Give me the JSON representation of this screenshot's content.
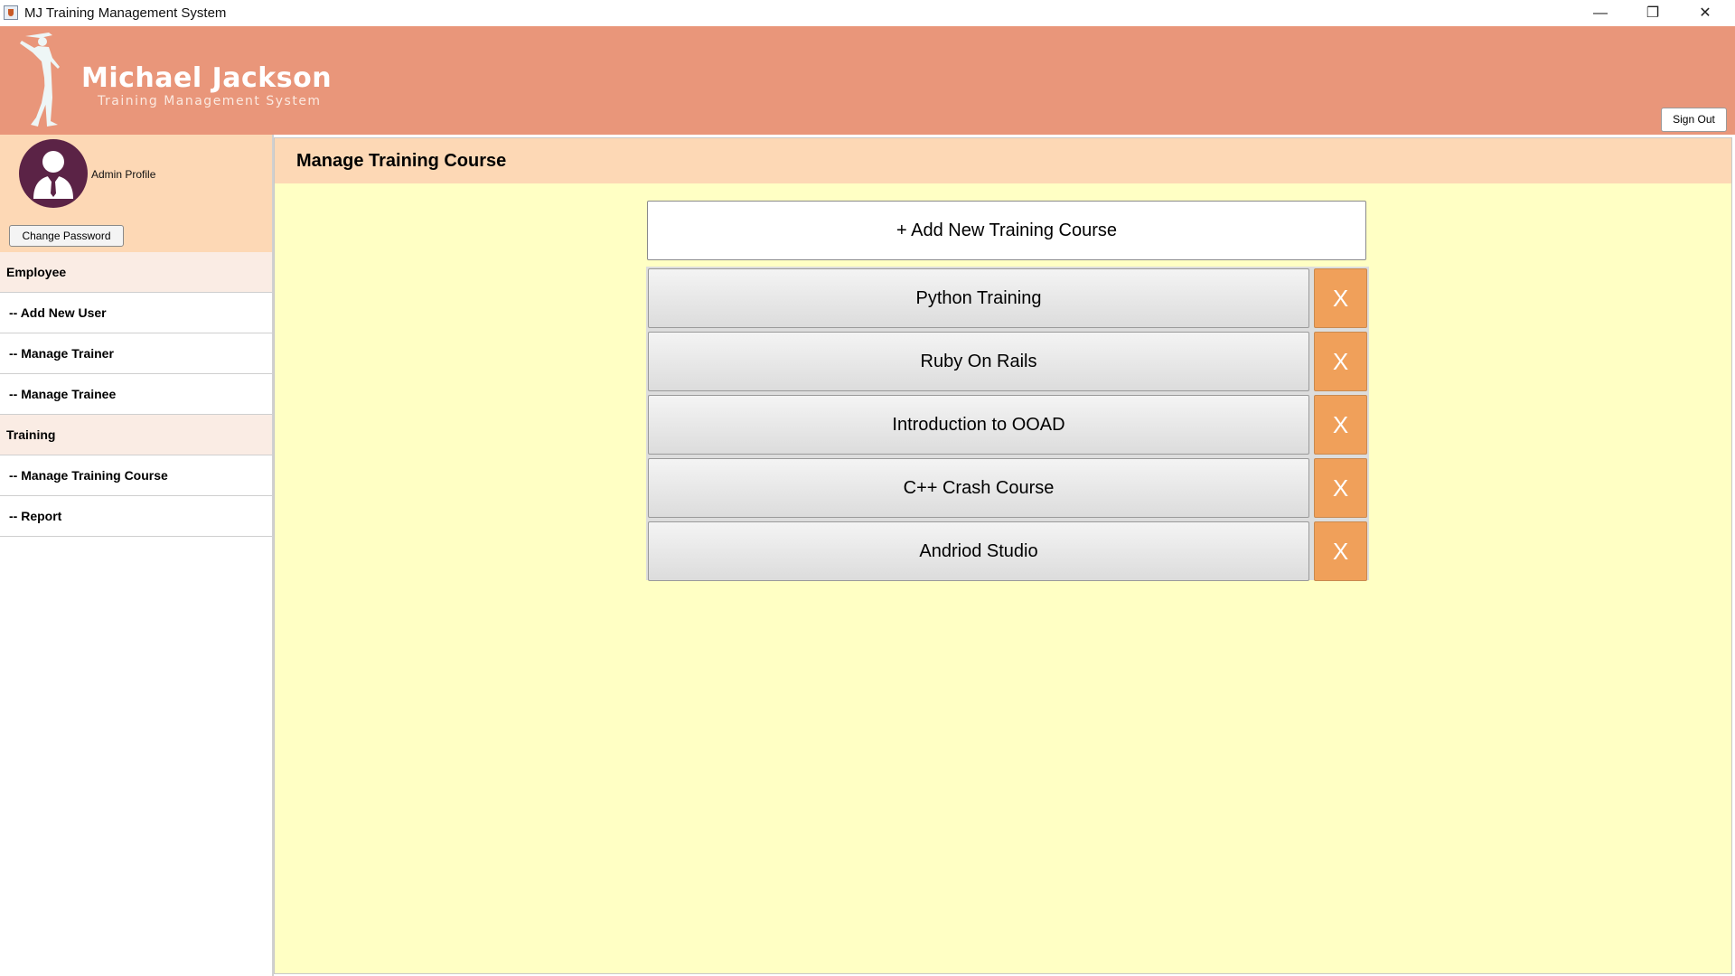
{
  "window": {
    "title": "MJ Training Management System",
    "controls": {
      "minimize": "—",
      "maximize": "❐",
      "close": "✕"
    }
  },
  "header": {
    "brand_name": "Michael Jackson",
    "brand_subtitle": "Training Management System",
    "sign_out_label": "Sign Out",
    "background_color": "#e9967a"
  },
  "sidebar": {
    "profile_label": "Admin Profile",
    "change_password_label": "Change Password",
    "sections": [
      {
        "title": "Employee",
        "items": [
          "-- Add New User",
          "-- Manage Trainer",
          "-- Manage Trainee"
        ]
      },
      {
        "title": "Training",
        "items": [
          "-- Manage Training Course",
          "-- Report"
        ]
      }
    ]
  },
  "main": {
    "title": "Manage Training Course",
    "add_button_label": "+ Add New Training Course",
    "delete_label": "X",
    "courses": [
      "Python Training",
      "Ruby On Rails",
      "Introduction to OOAD",
      "C++ Crash Course",
      "Andriod Studio"
    ]
  },
  "colors": {
    "panel_header": "#fdd8b5",
    "panel_background": "#ffffc4",
    "delete_button": "#f0a05a",
    "avatar_background": "#5b2346"
  }
}
